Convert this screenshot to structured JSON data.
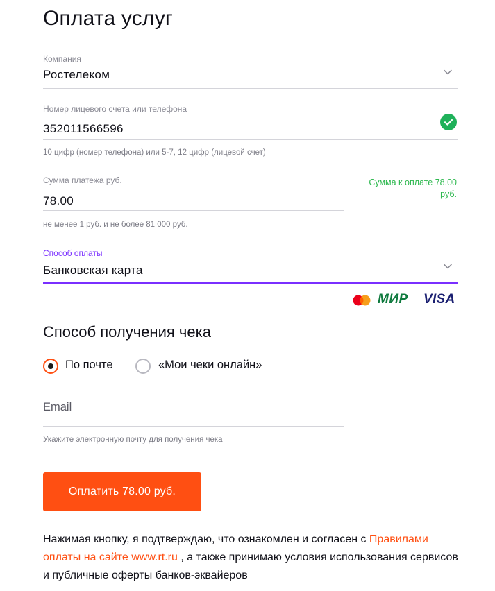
{
  "page": {
    "title": "Оплата услуг"
  },
  "company": {
    "label": "Компания",
    "value": "Ростелеком",
    "icon": "chevron-down-icon"
  },
  "account": {
    "label": "Номер лицевого счета или телефона",
    "value": "352011566596",
    "hint": "10 цифр (номер телефона) или 5-7, 12 цифр (лицевой счет)",
    "status_icon": "check-circle-icon",
    "status_color": "#1fb15a"
  },
  "amount": {
    "label": "Сумма платежа руб.",
    "value": "78.00",
    "hint": "не менее 1 руб. и не более 81 000 руб.",
    "total_note": "Сумма к оплате 78.00 руб."
  },
  "payment_method": {
    "label": "Способ оплаты",
    "value": "Банковская карта",
    "icon": "chevron-down-icon",
    "active_color": "#7a2fff",
    "logos": {
      "mir": "МИР",
      "visa": "VISA"
    }
  },
  "receipt": {
    "title": "Способ получения чека",
    "options": [
      {
        "label": "По почте",
        "selected": true
      },
      {
        "label": "«Мои чеки онлайн»",
        "selected": false
      }
    ],
    "email_placeholder": "Email",
    "email_hint": "Укажите электронную почту для получения чека"
  },
  "pay_button": {
    "label": "Оплатить 78.00 руб.",
    "color": "#ff4f12"
  },
  "legal": {
    "text_before": "Нажимая кнопку, я подтверждаю, что ознакомлен и согласен с ",
    "link": "Правилами оплаты на сайте www.rt.ru",
    "text_after": " , а также принимаю условия использования сервисов и публичные оферты банков-эквайеров"
  }
}
